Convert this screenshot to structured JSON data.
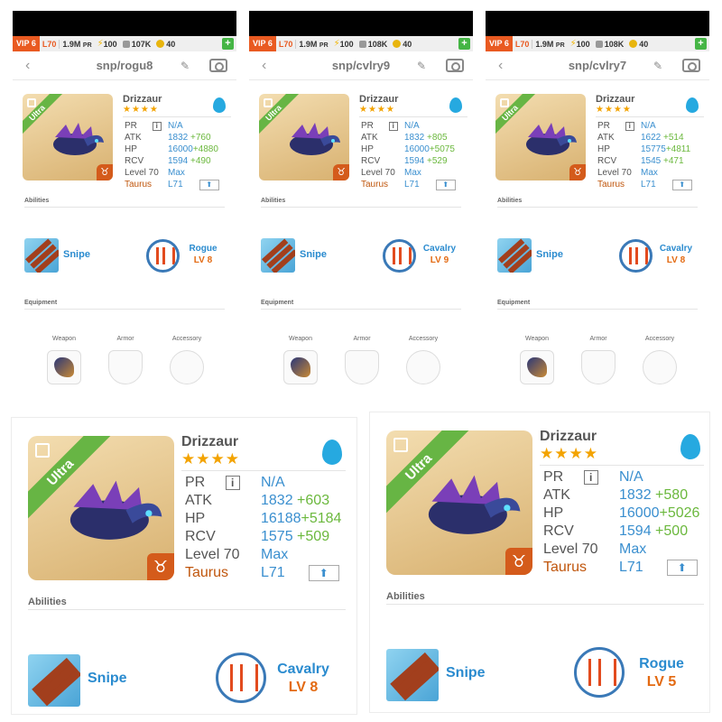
{
  "status_bar": {
    "vip": "VIP 6",
    "level": "L70",
    "pr": "1.9M",
    "pr_suffix": "PR",
    "energy": "100",
    "gold": "40",
    "plus": "+"
  },
  "icons": {
    "back": "back-chevron-icon",
    "edit": "pencil-icon",
    "camera": "camera-icon",
    "element": "water-drop-icon",
    "sign": "taurus-icon",
    "level_up": "up-arrow-icon"
  },
  "colors": {
    "vip": "#e95a21",
    "value": "#3a8fcf",
    "bonus": "#6bb83d",
    "stars": "#f3a300",
    "ultra": "#67b544",
    "lv": "#e36a12",
    "taurus": "#c0560d"
  },
  "labels": {
    "pr": "PR",
    "info": "i",
    "atk": "ATK",
    "hp": "HP",
    "rcv": "RCV",
    "level": "Level 70",
    "max": "Max",
    "sign": "Taurus",
    "rank": "L71",
    "abilities": "Abilities",
    "equipment": "Equipment",
    "weapon": "Weapon",
    "armor": "Armor",
    "accessory": "Accessory",
    "ultra": "Ultra",
    "stars": "★★★★",
    "na": "N/A",
    "up": "⬆"
  },
  "panels": [
    {
      "resources": "107K",
      "title": "snp/rogu8",
      "name": "Drizzaur",
      "atk": "1832",
      "atk_bonus": "+760",
      "hp": "16000",
      "hp_bonus": "+4880",
      "rcv": "1594",
      "rcv_bonus": "+490",
      "skill": "Snipe",
      "class": "Rogue",
      "class_lv": "LV 8"
    },
    {
      "resources": "108K",
      "title": "snp/cvlry9",
      "name": "Drizzaur",
      "atk": "1832",
      "atk_bonus": "+805",
      "hp": "16000",
      "hp_bonus": "+5075",
      "rcv": "1594",
      "rcv_bonus": "+529",
      "skill": "Snipe",
      "class": "Cavalry",
      "class_lv": "LV 9"
    },
    {
      "resources": "108K",
      "title": "snp/cvlry7",
      "name": "Drizzaur",
      "atk": "1622",
      "atk_bonus": "+514",
      "hp": "15775",
      "hp_bonus": "+4811",
      "rcv": "1545",
      "rcv_bonus": "+471",
      "skill": "Snipe",
      "class": "Cavalry",
      "class_lv": "LV 8"
    }
  ],
  "big_panels": [
    {
      "name": "Drizzaur",
      "atk": "1832",
      "atk_bonus": "+603",
      "hp": "16188",
      "hp_bonus": "+5184",
      "rcv": "1575",
      "rcv_bonus": "+509",
      "skill": "Snipe",
      "class": "Cavalry",
      "class_lv": "LV 8"
    },
    {
      "name": "Drizzaur",
      "atk": "1832",
      "atk_bonus": "+580",
      "hp": "16000",
      "hp_bonus": "+5026",
      "rcv": "1594",
      "rcv_bonus": "+500",
      "skill": "Snipe",
      "class": "Rogue",
      "class_lv": "LV 5"
    }
  ]
}
